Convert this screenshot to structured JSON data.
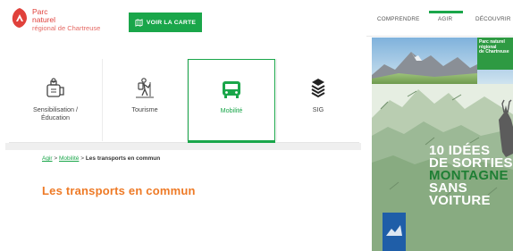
{
  "logo": {
    "line1": "Parc",
    "line2": "naturel",
    "line3": "régional de Chartreuse"
  },
  "header": {
    "map_button": "VOIR LA CARTE",
    "nav": [
      {
        "label": "COMPRENDRE"
      },
      {
        "label": "AGIR",
        "active": true
      },
      {
        "label": "DÉCOUVRIR"
      }
    ]
  },
  "categories": [
    {
      "label_line1": "Sensibilisation /",
      "label_line2": "Éducation",
      "icon": "kit-icon"
    },
    {
      "label_line1": "Tourisme",
      "label_line2": "",
      "icon": "hiker-icon"
    },
    {
      "label_line1": "Mobilité",
      "label_line2": "",
      "icon": "bus-icon",
      "active": true
    },
    {
      "label_line1": "SIG",
      "label_line2": "",
      "icon": "layers-icon"
    }
  ],
  "breadcrumb": {
    "home": "Agir",
    "section": "Mobilité",
    "current": "Les transports en commun",
    "separator": ">"
  },
  "page_title": "Les transports en commun",
  "poster": {
    "badge_line1": "Parc naturel",
    "badge_line2": "régional",
    "badge_line3": "de Chartreuse",
    "line1": "10 IDÉES",
    "line2": "DE SORTIES",
    "line3": "MONTAGNE",
    "line4": "SANS",
    "line5": "VOITURE"
  },
  "colors": {
    "brand_green": "#1aa64a",
    "title_orange": "#ee7a26",
    "logo_red": "#e0413b",
    "poster_green": "#2f9a3f"
  }
}
